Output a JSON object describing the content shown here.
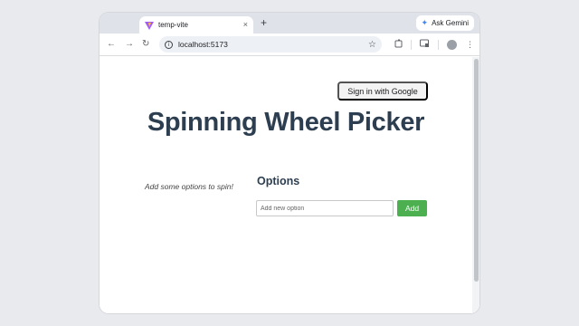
{
  "browser": {
    "tab_title": "temp-vite",
    "tab_close": "×",
    "new_tab": "+",
    "ask_gemini": "Ask Gemini",
    "url": "localhost:5173",
    "nav": {
      "back": "←",
      "forward": "→",
      "reload": "↻"
    },
    "bookmark_icon": "☆"
  },
  "page": {
    "signin_label": "Sign in with Google",
    "title": "Spinning Wheel Picker",
    "empty_message": "Add some options to spin!",
    "options_heading": "Options",
    "option_input_placeholder": "Add new option",
    "add_label": "Add"
  },
  "colors": {
    "accent_green": "#4caf50",
    "title_color": "#2c3e50"
  }
}
